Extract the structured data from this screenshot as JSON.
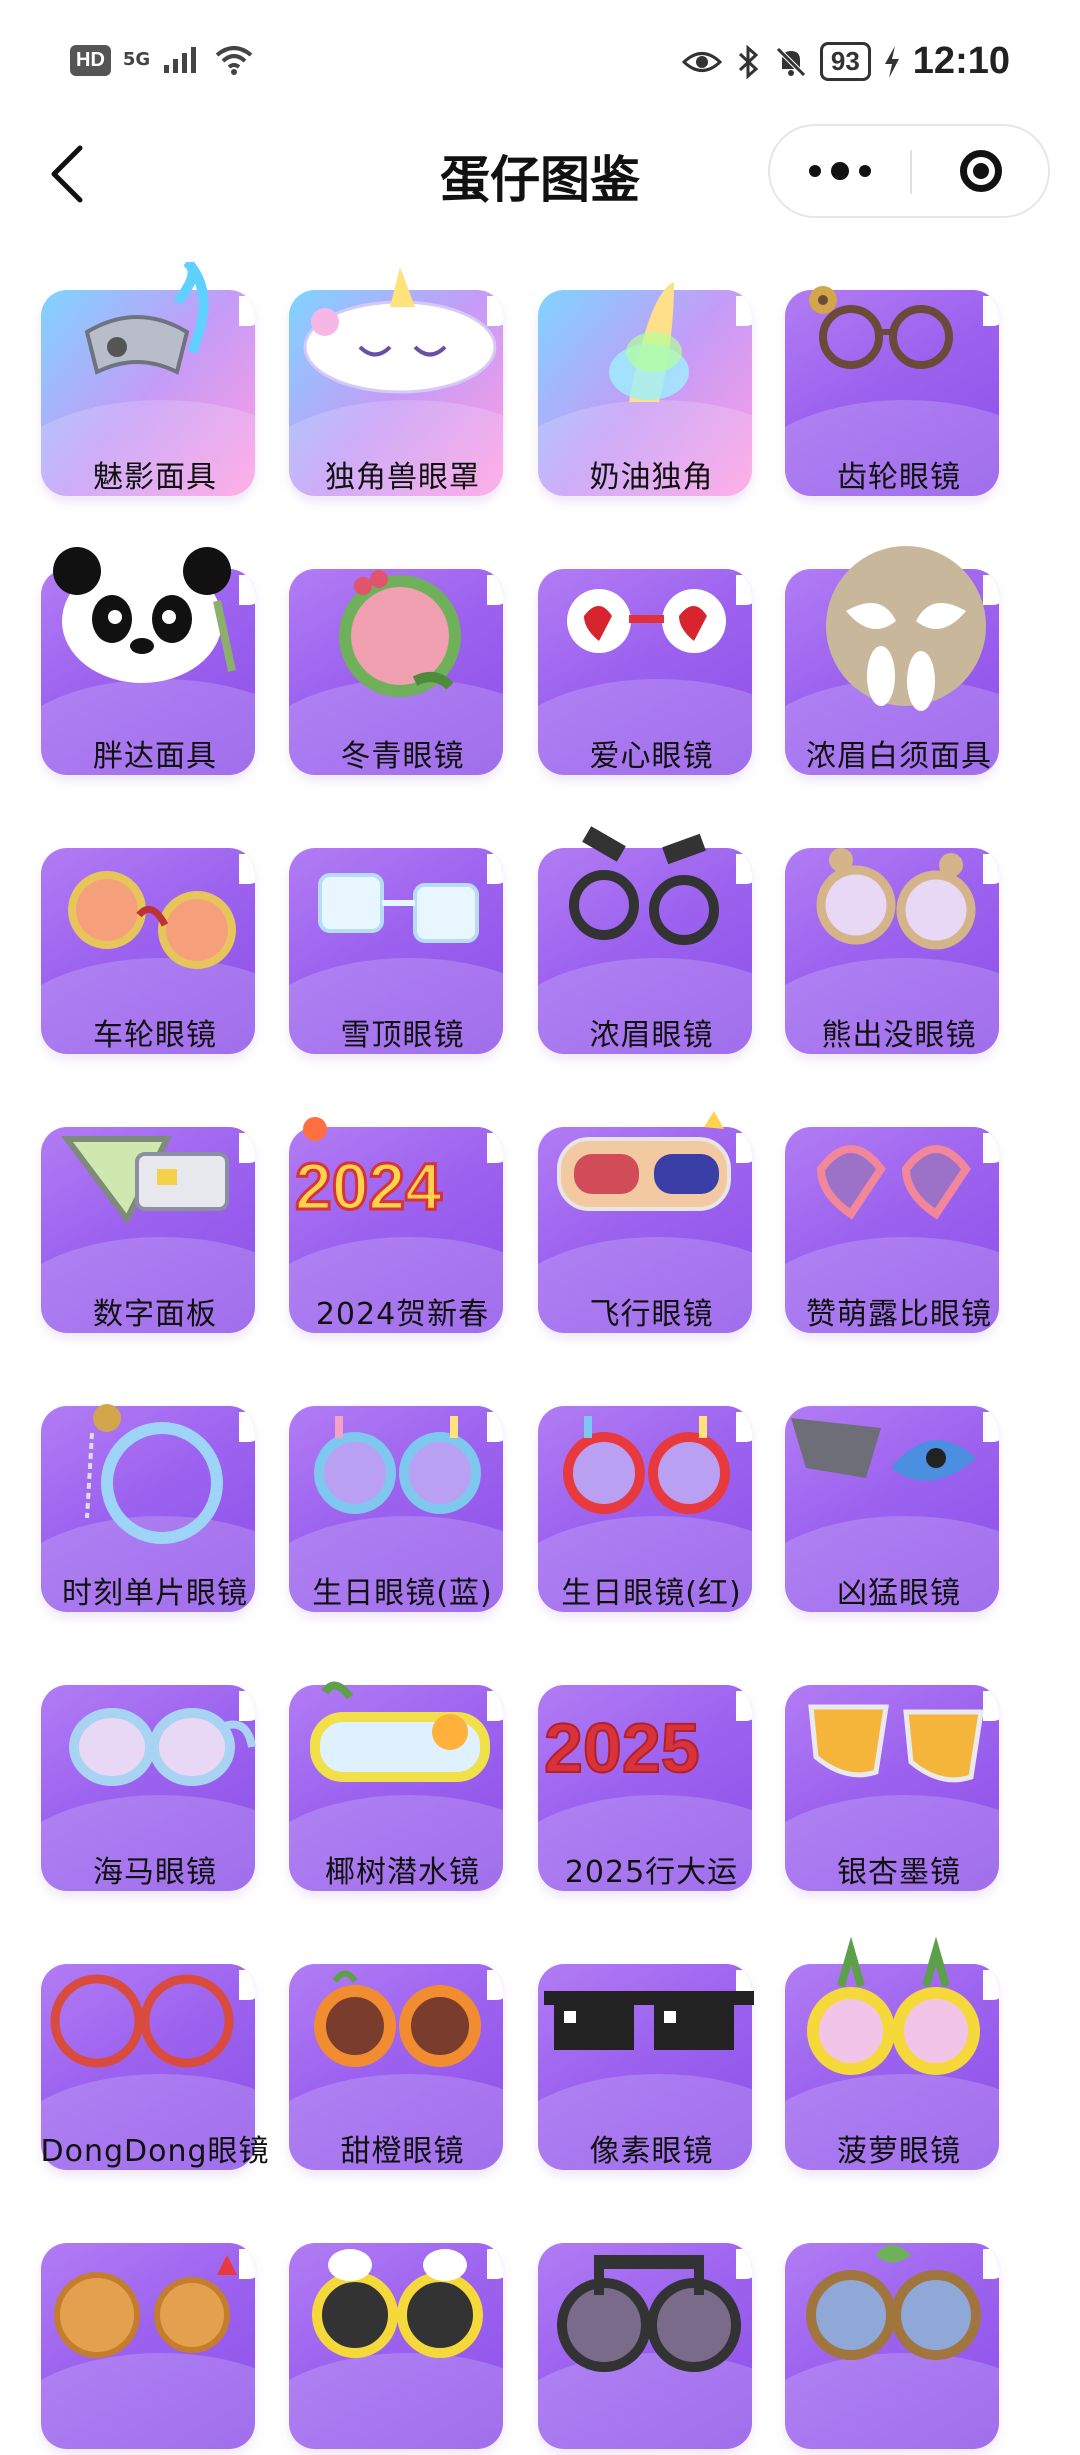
{
  "status_bar": {
    "hd": "HD",
    "network": "5G",
    "battery": "93",
    "time": "12:10"
  },
  "nav": {
    "title": "蛋仔图鉴"
  },
  "items": [
    {
      "label": "魅影面具",
      "icon": "phantom-mask",
      "bg": "rainbow"
    },
    {
      "label": "独角兽眼罩",
      "icon": "unicorn-eye-mask",
      "bg": "rainbow"
    },
    {
      "label": "奶油独角",
      "icon": "cream-horn",
      "bg": "rainbow"
    },
    {
      "label": "齿轮眼镜",
      "icon": "gear-glasses",
      "bg": "purple"
    },
    {
      "label": "胖达面具",
      "icon": "panda-mask",
      "bg": "purple"
    },
    {
      "label": "冬青眼镜",
      "icon": "holly-glasses",
      "bg": "purple"
    },
    {
      "label": "爱心眼镜",
      "icon": "heart-glasses",
      "bg": "purple"
    },
    {
      "label": "浓眉白须面具",
      "icon": "brow-beard-mask",
      "bg": "purple"
    },
    {
      "label": "车轮眼镜",
      "icon": "wheel-glasses",
      "bg": "purple"
    },
    {
      "label": "雪顶眼镜",
      "icon": "ice-glasses",
      "bg": "purple"
    },
    {
      "label": "浓眉眼镜",
      "icon": "brow-glasses",
      "bg": "purple"
    },
    {
      "label": "熊出没眼镜",
      "icon": "bear-glasses",
      "bg": "purple"
    },
    {
      "label": "数字面板",
      "icon": "digital-panel",
      "bg": "purple"
    },
    {
      "label": "2024贺新春",
      "icon": "new-year-2024",
      "bg": "purple"
    },
    {
      "label": "飞行眼镜",
      "icon": "flight-goggles",
      "bg": "purple"
    },
    {
      "label": "赞萌露比眼镜",
      "icon": "heart-sunglasses",
      "bg": "purple"
    },
    {
      "label": "时刻单片眼镜",
      "icon": "monocle",
      "bg": "purple"
    },
    {
      "label": "生日眼镜(蓝)",
      "icon": "birthday-glasses-blue",
      "bg": "purple"
    },
    {
      "label": "生日眼镜(红)",
      "icon": "birthday-glasses-red",
      "bg": "purple"
    },
    {
      "label": "凶猛眼镜",
      "icon": "fierce-glasses",
      "bg": "purple"
    },
    {
      "label": "海马眼镜",
      "icon": "seahorse-glasses",
      "bg": "purple"
    },
    {
      "label": "椰树潜水镜",
      "icon": "palm-dive-goggles",
      "bg": "purple"
    },
    {
      "label": "2025行大运",
      "icon": "new-year-2025",
      "bg": "purple"
    },
    {
      "label": "银杏墨镜",
      "icon": "ginkgo-sunglasses",
      "bg": "purple"
    },
    {
      "label": "DongDong眼镜",
      "icon": "dongdong-glasses",
      "bg": "purple"
    },
    {
      "label": "甜橙眼镜",
      "icon": "orange-glasses",
      "bg": "purple"
    },
    {
      "label": "像素眼镜",
      "icon": "pixel-glasses",
      "bg": "purple"
    },
    {
      "label": "菠萝眼镜",
      "icon": "pineapple-glasses",
      "bg": "purple"
    },
    {
      "label": "",
      "icon": "waffle-glasses",
      "bg": "purple"
    },
    {
      "label": "",
      "icon": "cloud-sunglasses",
      "bg": "purple"
    },
    {
      "label": "",
      "icon": "music-glasses",
      "bg": "purple"
    },
    {
      "label": "",
      "icon": "leaf-glasses",
      "bg": "purple"
    }
  ]
}
